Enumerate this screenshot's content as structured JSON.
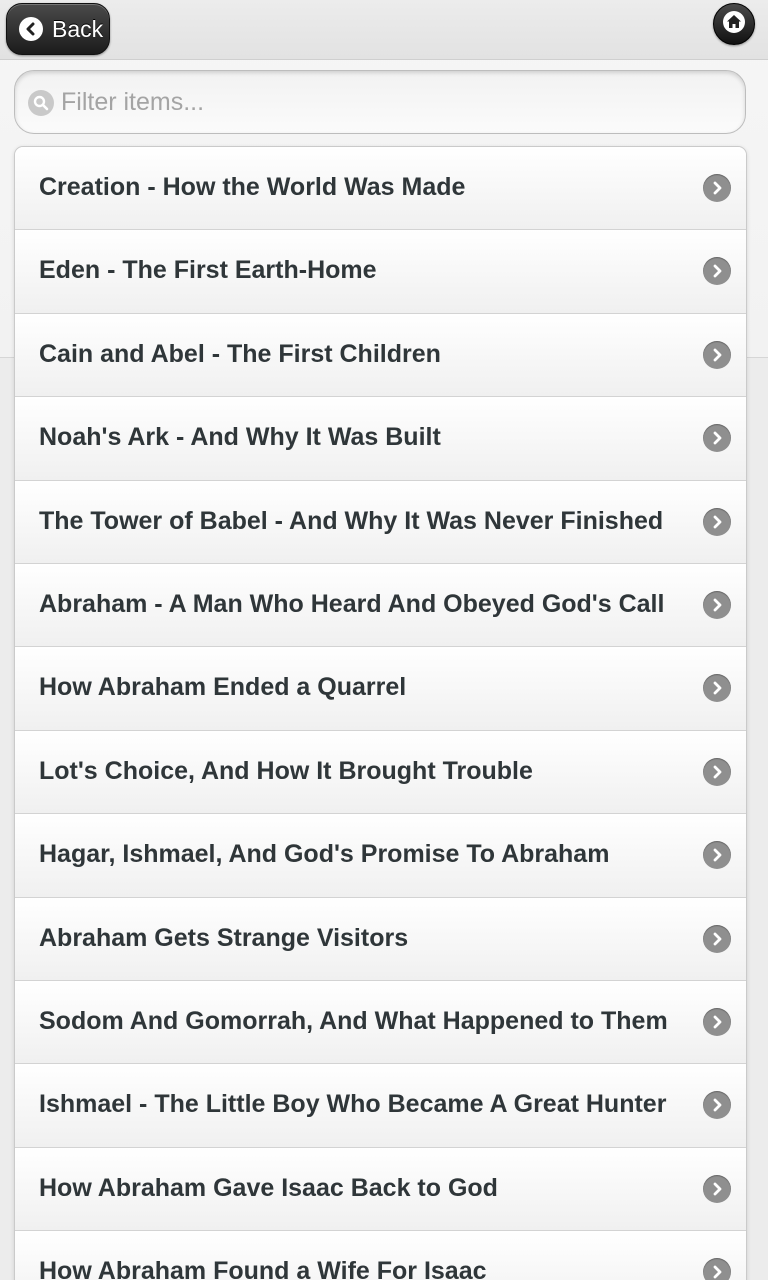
{
  "header": {
    "back_label": "Back",
    "back_icon": "chevron-left-icon",
    "home_icon": "home-icon"
  },
  "search": {
    "placeholder": "Filter items...",
    "value": "",
    "icon": "search-icon"
  },
  "list": {
    "arrow_icon": "chevron-right-icon",
    "items": [
      {
        "label": "Creation - How the World Was Made"
      },
      {
        "label": "Eden - The First Earth-Home"
      },
      {
        "label": "Cain and Abel - The First Children"
      },
      {
        "label": "Noah's Ark - And Why It Was Built"
      },
      {
        "label": "The Tower of Babel - And Why It Was Never Finished"
      },
      {
        "label": "Abraham - A Man Who Heard And Obeyed God's Call"
      },
      {
        "label": "How Abraham Ended a Quarrel"
      },
      {
        "label": "Lot's Choice, And How It Brought Trouble"
      },
      {
        "label": "Hagar, Ishmael, And God's Promise To Abraham"
      },
      {
        "label": "Abraham Gets Strange Visitors"
      },
      {
        "label": "Sodom And Gomorrah, And What Happened to Them"
      },
      {
        "label": "Ishmael - The Little Boy Who Became A Great Hunter"
      },
      {
        "label": "How Abraham Gave Isaac Back to God"
      },
      {
        "label": "How Abraham Found a Wife For Isaac"
      }
    ]
  }
}
